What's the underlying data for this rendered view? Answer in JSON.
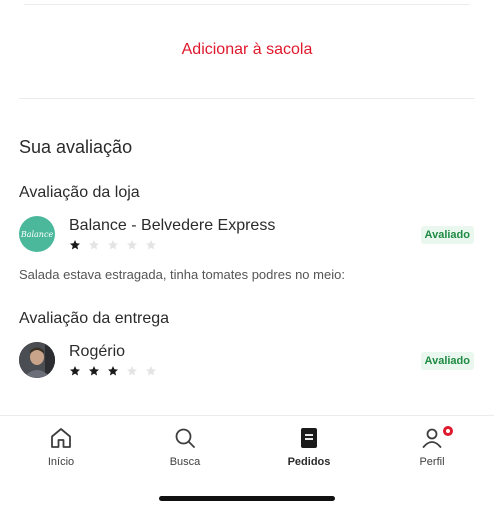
{
  "actions": {
    "add_to_bag_label": "Adicionar à sacola"
  },
  "review": {
    "title": "Sua avaliação",
    "store": {
      "heading": "Avaliação da loja",
      "name": "Balance - Belvedere Express",
      "logo_text": "Balance",
      "rating": 1,
      "max_rating": 5,
      "status": "Avaliado",
      "comment": "Salada estava estragada, tinha tomates podres no meio:"
    },
    "delivery": {
      "heading": "Avaliação da entrega",
      "courier_name": "Rogério",
      "rating": 3,
      "max_rating": 5,
      "status": "Avaliado"
    }
  },
  "tabbar": {
    "items": [
      {
        "label": "Início",
        "icon": "home-icon",
        "active": false
      },
      {
        "label": "Busca",
        "icon": "search-icon",
        "active": false
      },
      {
        "label": "Pedidos",
        "icon": "orders-icon",
        "active": true
      },
      {
        "label": "Perfil",
        "icon": "profile-icon",
        "active": false,
        "has_notification": true
      }
    ]
  },
  "colors": {
    "accent": "#e0182c",
    "badge_bg": "#eaf7ee",
    "badge_text": "#1e8a43",
    "store_logo": "#4bb89c",
    "star_filled": "#1a1a1a",
    "star_empty": "#e4e4e4"
  }
}
